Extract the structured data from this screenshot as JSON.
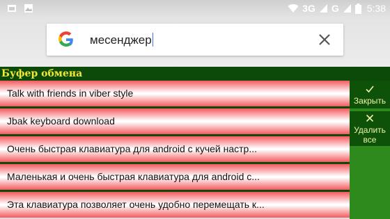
{
  "status_bar": {
    "network_1": "3G",
    "network_2": "G",
    "time": "5:38"
  },
  "search": {
    "query": "месенджер",
    "logo": "google-g-logo",
    "clear_icon": "close-icon"
  },
  "clipboard": {
    "title": "Буфер обмена",
    "items": [
      "Talk with friends in viber style",
      "Jbak keyboard download",
      "Очень быстрая клавиатура для android с кучей настр...",
      "Маленькая и очень быстрая клавиатура для android с...",
      "Эта клавиатура позволяет очень удобно перемещать к..."
    ],
    "close_label": "Закрыть",
    "delete_all_label_1": "Удалить",
    "delete_all_label_2": "все"
  },
  "colors": {
    "header_bg": "#0b4a08",
    "title_color": "#f1e73b",
    "item_red": "#f35a5e",
    "side_panel": "#2f8a1e",
    "button_label": "#eef4a8"
  }
}
